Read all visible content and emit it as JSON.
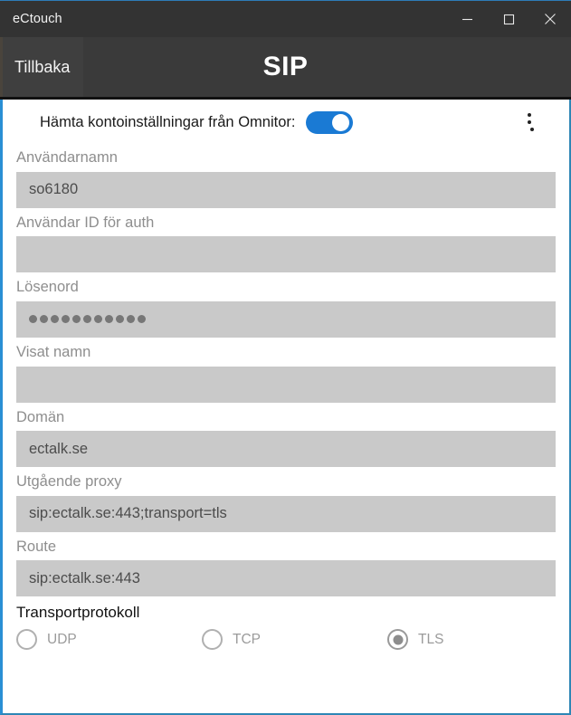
{
  "window": {
    "title": "eCtouch",
    "controls": {
      "minimize": "minimize-icon",
      "maximize": "maximize-icon",
      "close": "close-icon"
    }
  },
  "header": {
    "back_label": "Tillbaka",
    "page_title": "SIP"
  },
  "colors": {
    "accent_blue": "#1a7ad4",
    "window_border_blue": "#2a8fd4",
    "titlebar_bg": "#333333",
    "header_bg": "#3a3a3a",
    "input_bg": "#c9c9c9",
    "label_gray": "#8e8e8e"
  },
  "toggle_row": {
    "label": "Hämta kontoinställningar från Omnitor:",
    "state": "on",
    "overflow_menu": "more-vertical-icon"
  },
  "fields": [
    {
      "label": "Användarnamn",
      "value": "so6180",
      "type": "text"
    },
    {
      "label": "Användar ID för auth",
      "value": "",
      "type": "text"
    },
    {
      "label": "Lösenord",
      "value": "",
      "masked_count": 11,
      "type": "password"
    },
    {
      "label": "Visat namn",
      "value": "",
      "type": "text"
    },
    {
      "label": "Domän",
      "value": "ectalk.se",
      "type": "text"
    },
    {
      "label": "Utgående proxy",
      "value": "sip:ectalk.se:443;transport=tls",
      "type": "text"
    },
    {
      "label": "Route",
      "value": "sip:ectalk.se:443",
      "type": "text"
    }
  ],
  "transport": {
    "title": "Transportprotokoll",
    "selected": "TLS",
    "options": [
      {
        "label": "UDP",
        "checked": false
      },
      {
        "label": "TCP",
        "checked": false
      },
      {
        "label": "TLS",
        "checked": true
      }
    ]
  }
}
